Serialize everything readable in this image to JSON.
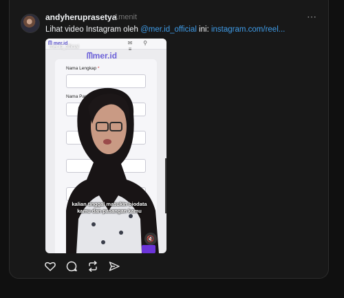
{
  "post": {
    "username": "andyheruprasetya",
    "time": "1menit",
    "more_icon": "⋯",
    "text_prefix": "Lihat video Instagram oleh ",
    "mention": "@mer.id_official",
    "text_mid": " ini: ",
    "link": "instagram.com/reel..."
  },
  "video": {
    "small_logo": "mer.id",
    "watermark": "mer.id_official",
    "big_logo": "mer.id",
    "form_fields": [
      {
        "label": "Nama Lengkap",
        "req": "*"
      },
      {
        "label": "Nama Panggilan",
        "req": "*"
      }
    ],
    "caption_line1": "kalian tinggal masukin biodata",
    "caption_line2": "kamu dan pasangan kamu"
  },
  "actions": {
    "like_icon": "heart-icon",
    "comment_icon": "comment-icon",
    "repost_icon": "repost-icon",
    "share_icon": "share-icon"
  },
  "colors": {
    "background": "#101010",
    "card": "#181818",
    "link": "#3f9ce8",
    "brand_purple": "#6a5fd8"
  }
}
